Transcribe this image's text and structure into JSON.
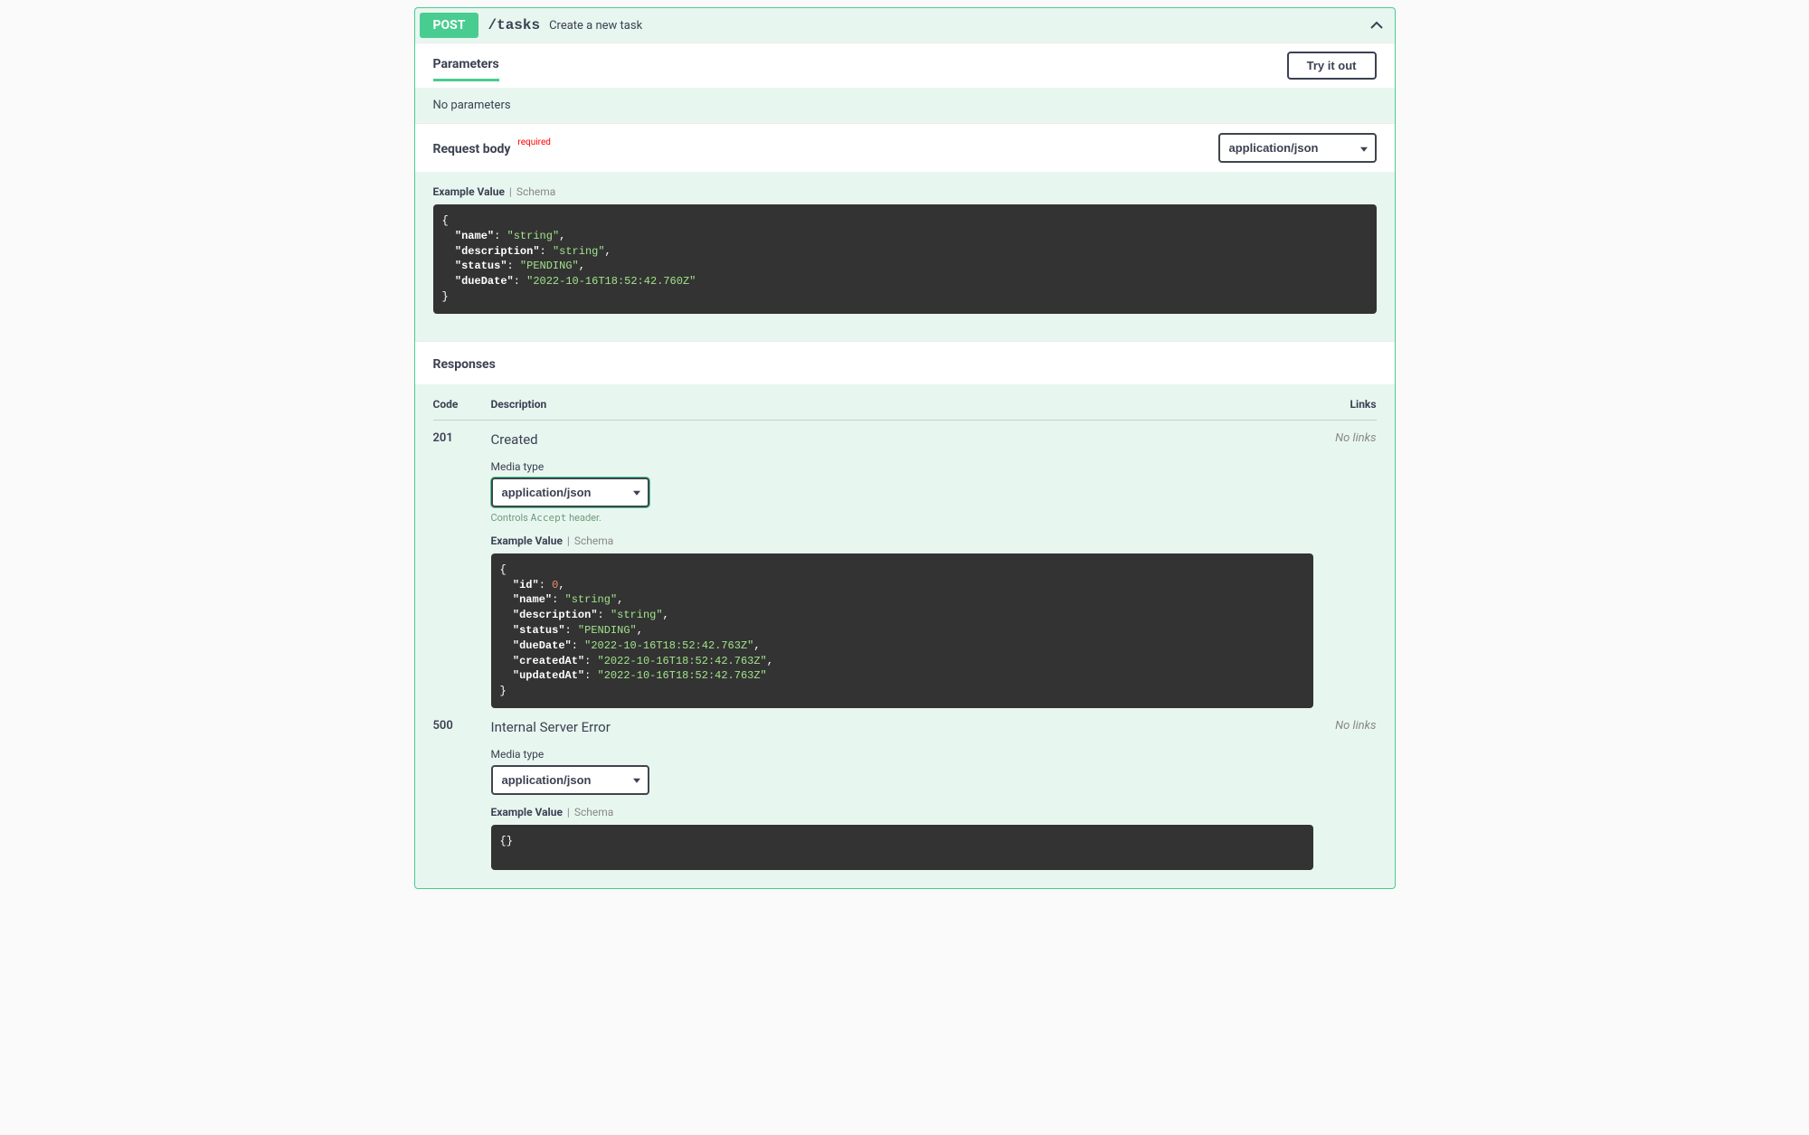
{
  "operation": {
    "method": "POST",
    "path": "/tasks",
    "summary": "Create a new task"
  },
  "parameters": {
    "title": "Parameters",
    "tryItOut": "Try it out",
    "noParams": "No parameters"
  },
  "requestBody": {
    "title": "Request body",
    "required": "required",
    "contentType": "application/json",
    "tabs": {
      "example": "Example Value",
      "schema": "Schema"
    }
  },
  "exampleRequest": {
    "name": "string",
    "description": "string",
    "status": "PENDING",
    "dueDate": "2022-10-16T18:52:42.760Z"
  },
  "responsesTitle": "Responses",
  "responseHeaders": {
    "code": "Code",
    "description": "Description",
    "links": "Links"
  },
  "noLinks": "No links",
  "mediaTypeLabel": "Media type",
  "acceptHint": {
    "prefix": "Controls ",
    "code": "Accept",
    "suffix": " header."
  },
  "responses": [
    {
      "code": "201",
      "description": "Created",
      "mediaType": "application/json",
      "greenBorder": true,
      "showAcceptHint": true,
      "example": {
        "id": 0,
        "name": "string",
        "description": "string",
        "status": "PENDING",
        "dueDate": "2022-10-16T18:52:42.763Z",
        "createdAt": "2022-10-16T18:52:42.763Z",
        "updatedAt": "2022-10-16T18:52:42.763Z"
      }
    },
    {
      "code": "500",
      "description": "Internal Server Error",
      "mediaType": "application/json",
      "greenBorder": false,
      "showAcceptHint": false,
      "example": {}
    }
  ]
}
